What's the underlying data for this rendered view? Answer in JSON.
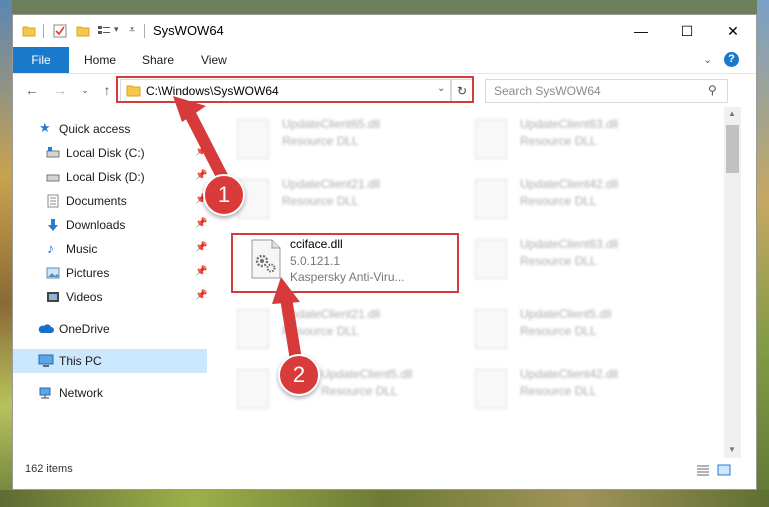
{
  "window": {
    "title": "SysWOW64"
  },
  "ribbon": {
    "tabs": [
      "File",
      "Home",
      "Share",
      "View"
    ]
  },
  "address": {
    "path": "C:\\Windows\\SysWOW64"
  },
  "search": {
    "placeholder": "Search SysWOW64"
  },
  "nav": {
    "items": [
      {
        "label": "Quick access",
        "icon": "star-icon",
        "pinned": false
      },
      {
        "label": "Local Disk (C:)",
        "icon": "drive-icon",
        "pinned": true
      },
      {
        "label": "Local Disk (D:)",
        "icon": "drive-icon",
        "pinned": true
      },
      {
        "label": "Documents",
        "icon": "documents-icon",
        "pinned": true
      },
      {
        "label": "Downloads",
        "icon": "download-icon",
        "pinned": true
      },
      {
        "label": "Music",
        "icon": "music-icon",
        "pinned": true
      },
      {
        "label": "Pictures",
        "icon": "pictures-icon",
        "pinned": true
      },
      {
        "label": "Videos",
        "icon": "videos-icon",
        "pinned": true
      },
      {
        "label": "OneDrive",
        "icon": "cloud-icon",
        "pinned": false
      },
      {
        "label": "This PC",
        "icon": "computer-icon",
        "pinned": false,
        "selected": true
      },
      {
        "label": "Network",
        "icon": "network-icon",
        "pinned": false
      }
    ]
  },
  "files": {
    "left": [
      {
        "name": "UpdateClient65.dll",
        "type": "Resource DLL"
      },
      {
        "name": "UpdateClient21.dll",
        "type": "Resource DLL"
      },
      {
        "name": "cciface.dll",
        "version": "5.0.121.1",
        "desc": "Kaspersky Anti-Viru..."
      },
      {
        "name": "UpdateClient21.dll",
        "type": "Resource DLL"
      },
      {
        "name": "UpdateClient5.dll",
        "type": "Resource DLL"
      }
    ],
    "right": [
      {
        "name": "UpdateClient63.dll",
        "type": "Resource DLL"
      },
      {
        "name": "UpdateClient42.dll",
        "type": "Resource DLL"
      },
      {
        "name": "UpdateClient63.dll",
        "type": "Resource DLL"
      },
      {
        "name": "UpdateClient5.dll",
        "type": "Resource DLL"
      },
      {
        "name": "UpdateClient42.dll",
        "type": "Resource DLL"
      }
    ]
  },
  "status": {
    "item_count": "162 items"
  },
  "annotations": {
    "step1": "1",
    "step2": "2"
  },
  "colors": {
    "accent": "#1979ca",
    "annotation": "#d63a3a",
    "selected_bg": "#cce8ff"
  }
}
